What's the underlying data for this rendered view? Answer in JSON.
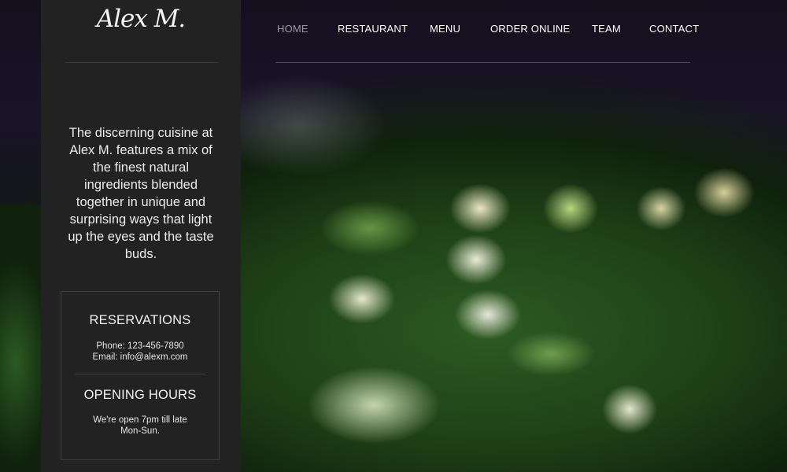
{
  "brand": {
    "logo_text": "Alex M."
  },
  "nav": {
    "items": [
      {
        "label": "HOME",
        "active": true
      },
      {
        "label": "RESTAURANT",
        "active": false
      },
      {
        "label": "MENU",
        "active": false
      },
      {
        "label": "ORDER ONLINE",
        "active": false
      },
      {
        "label": "TEAM",
        "active": false
      },
      {
        "label": "CONTACT",
        "active": false
      }
    ]
  },
  "sidebar": {
    "intro": "The discerning cuisine at Alex M. features a mix of the finest natural ingredients blended together in unique and surprising ways that light up the eyes and the taste buds.",
    "reservations": {
      "heading": "RESERVATIONS",
      "phone": "Phone:  123-456-7890",
      "email": "Email:  info@alexm.com"
    },
    "hours": {
      "heading": "OPENING HOURS",
      "line1": "We're open 7pm till late",
      "line2": "Mon-Sun."
    }
  },
  "colors": {
    "sidebar_bg": "#222222",
    "nav_active": "#9a9aa8",
    "nav_text": "#ffffff"
  }
}
